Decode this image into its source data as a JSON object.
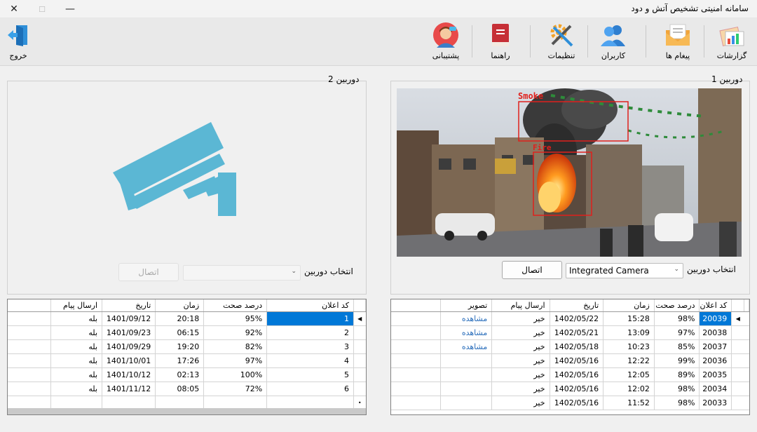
{
  "window": {
    "title": "سامانه امنیتی تشخیص آتش و دود",
    "close_glyph": "✕",
    "maximize_glyph": "☐",
    "minimize_glyph": "—"
  },
  "toolbar": {
    "reports": "گزارشات",
    "messages": "پیغام ها",
    "users": "کاربران",
    "settings": "تنظیمات",
    "guide": "راهنما",
    "support": "پشتیبانی",
    "exit": "خروج"
  },
  "camera1": {
    "title": "دوربین 1",
    "select_label": "انتخاب دوربین",
    "selected_camera": "Integrated Camera",
    "connect_label": "اتصال",
    "detections": [
      "Smoke",
      "Fire"
    ],
    "grid": {
      "columns": [
        "کد اعلان",
        "درصد صحت",
        "زمان",
        "تاریخ",
        "ارسال پیام",
        "تصویر"
      ],
      "rows": [
        [
          "20039",
          "98%",
          "15:28",
          "1402/05/22",
          "خیر",
          "مشاهده"
        ],
        [
          "20038",
          "97%",
          "13:09",
          "1402/05/21",
          "خیر",
          "مشاهده"
        ],
        [
          "20037",
          "85%",
          "10:23",
          "1402/05/18",
          "خیر",
          "مشاهده"
        ],
        [
          "20036",
          "99%",
          "12:22",
          "1402/05/16",
          "خیر",
          ""
        ],
        [
          "20035",
          "89%",
          "12:05",
          "1402/05/16",
          "خیر",
          ""
        ],
        [
          "20034",
          "98%",
          "12:02",
          "1402/05/16",
          "خیر",
          ""
        ],
        [
          "20033",
          "98%",
          "11:52",
          "1402/05/16",
          "خیر",
          ""
        ]
      ]
    }
  },
  "camera2": {
    "title": "دوربین 2",
    "select_label": "انتخاب دوربین",
    "selected_camera": "",
    "connect_label": "اتصال",
    "grid": {
      "columns": [
        "کد اعلان",
        "درصد صحت",
        "زمان",
        "تاریخ",
        "ارسال پیام"
      ],
      "rows": [
        [
          "1",
          "95%",
          "20:18",
          "1401/09/12",
          "بله"
        ],
        [
          "2",
          "92%",
          "06:15",
          "1401/09/23",
          "بله"
        ],
        [
          "3",
          "82%",
          "19:20",
          "1401/09/29",
          "بله"
        ],
        [
          "4",
          "97%",
          "17:26",
          "1401/10/01",
          "بله"
        ],
        [
          "5",
          "100%",
          "02:13",
          "1401/10/12",
          "بله"
        ],
        [
          "6",
          "72%",
          "08:05",
          "1401/11/12",
          "بله"
        ]
      ]
    }
  },
  "colors": {
    "selection": "#0078d7",
    "link": "#2a6ebb",
    "camera_icon": "#5bb7d4",
    "detection_box": "#e0201c"
  }
}
